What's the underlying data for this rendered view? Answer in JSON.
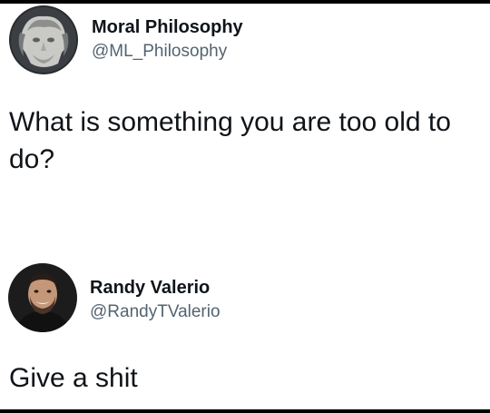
{
  "tweets": [
    {
      "display_name": "Moral Philosophy",
      "handle": "@ML_Philosophy",
      "text": "What is something you are too old to do?",
      "avatar_icon": "statue-bust-avatar"
    },
    {
      "display_name": "Randy Valerio",
      "handle": "@RandyTValerio",
      "text": "Give a shit",
      "avatar_icon": "person-portrait-avatar"
    }
  ],
  "colors": {
    "text": "#0f1419",
    "handle": "#536471",
    "border": "#000000"
  }
}
